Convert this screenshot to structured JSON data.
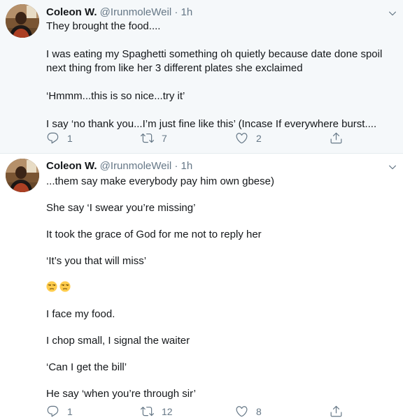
{
  "tweets": [
    {
      "name": "Coleon W.",
      "handle": "@IrunmoleWeil",
      "dot": "·",
      "time": "1h",
      "lines": [
        "They brought the food....",
        "I was eating my Spaghetti something oh quietly because date done spoil",
        "next thing from like her 3 different plates she exclaimed",
        "‘Hmmm...this is so nice...try it’",
        "I say ‘no thank you...I’m just fine like this’ (Incase If everywhere burst...."
      ],
      "replies": "1",
      "retweets": "7",
      "likes": "2"
    },
    {
      "name": "Coleon W.",
      "handle": "@IrunmoleWeil",
      "dot": "·",
      "time": "1h",
      "lines": [
        "...them say make everybody pay him own gbese)",
        "She say ‘I swear you’re missing’",
        "It took the grace of God for me not to reply her",
        "‘It’s you that will miss’",
        "I face my food.",
        "I chop small, I signal the waiter",
        "‘Can I get the bill’",
        "He say ‘when you’re through sir’"
      ],
      "emoji_count": 2,
      "replies": "1",
      "retweets": "12",
      "likes": "8"
    }
  ],
  "icons": [
    "reply-icon",
    "retweet-icon",
    "like-icon",
    "share-icon",
    "chevron-down-icon",
    "unamused-face-icon"
  ],
  "colors": {
    "text": "#14171a",
    "muted": "#657786",
    "highlight_bg": "#f5f8fa",
    "divider": "#e6ecf0"
  }
}
